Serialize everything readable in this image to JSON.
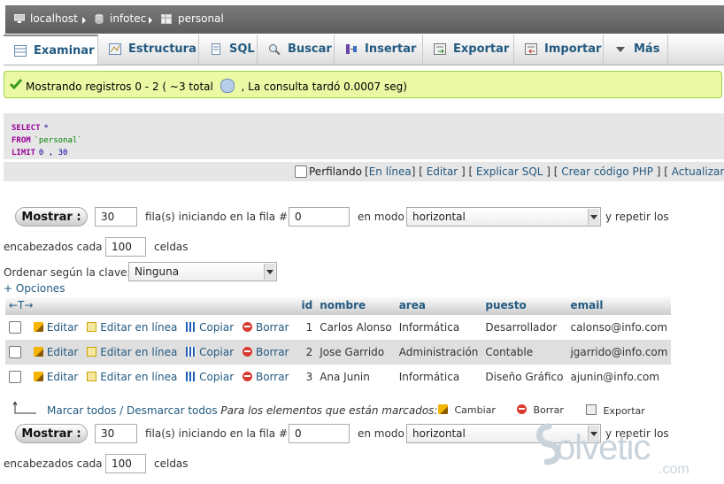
{
  "breadcrumb": {
    "server": "localhost",
    "database": "infotec",
    "table": "personal"
  },
  "tabs": [
    {
      "label": "Examinar",
      "icon": "browse-icon",
      "active": true
    },
    {
      "label": "Estructura",
      "icon": "structure-icon"
    },
    {
      "label": "SQL",
      "icon": "sql-icon"
    },
    {
      "label": "Buscar",
      "icon": "search-icon"
    },
    {
      "label": "Insertar",
      "icon": "insert-icon"
    },
    {
      "label": "Exportar",
      "icon": "export-icon"
    },
    {
      "label": "Importar",
      "icon": "import-icon"
    },
    {
      "label": "Más",
      "icon": "more-chevron-icon"
    }
  ],
  "message": {
    "prefix": "Mostrando registros 0 - 2 ( ~3 total",
    "suffix": ", La consulta tardó 0.0007 seg)",
    "success_color": "#ebf8a4"
  },
  "sql": {
    "kw1": "SELECT",
    "star": "*",
    "kw2": "FROM",
    "table": "`personal`",
    "kw3": "LIMIT",
    "limit": "0 , 30"
  },
  "sql_tools": {
    "profiling_label": "Perfilando",
    "links": [
      "En línea",
      "Editar",
      "Explicar SQL",
      "Crear código PHP",
      "Actualizar"
    ]
  },
  "nav": {
    "show_button": "Mostrar :",
    "rows_value": "30",
    "rows_label": "fila(s) iniciando en la fila #",
    "start_value": "0",
    "mode_label": "en modo",
    "mode_value": "horizontal",
    "repeat_label": "y repetir los",
    "headers_label": "encabezados cada",
    "headers_value": "100",
    "cells_label": "celdas"
  },
  "sort": {
    "label": "Ordenar según la clave:",
    "value": "Ninguna"
  },
  "options_link": "+ Opciones",
  "table": {
    "columns": [
      "id",
      "nombre",
      "area",
      "puesto",
      "email"
    ],
    "rows": [
      {
        "id": "1",
        "nombre": "Carlos Alonso",
        "area": "Informática",
        "puesto": "Desarrollador",
        "email": "calonso@info.com"
      },
      {
        "id": "2",
        "nombre": "Jose Garrido",
        "area": "Administración",
        "puesto": "Contable",
        "email": "jgarrido@info.com"
      },
      {
        "id": "3",
        "nombre": "Ana Junin",
        "area": "Informática",
        "puesto": "Diseño Gráfico",
        "email": "ajunin@info.com"
      }
    ],
    "actions": {
      "edit": "Editar",
      "edit_inline": "Editar en línea",
      "copy": "Copiar",
      "delete": "Borrar"
    }
  },
  "bulk": {
    "check_all": "Marcar todos",
    "separator": "/",
    "uncheck_all": "Desmarcar todos",
    "for_marked": "Para los elementos que están marcados:",
    "change": "Cambiar",
    "delete": "Borrar",
    "export": "Exportar"
  },
  "watermark": {
    "text": "olvetic",
    "suffix": ".com"
  }
}
